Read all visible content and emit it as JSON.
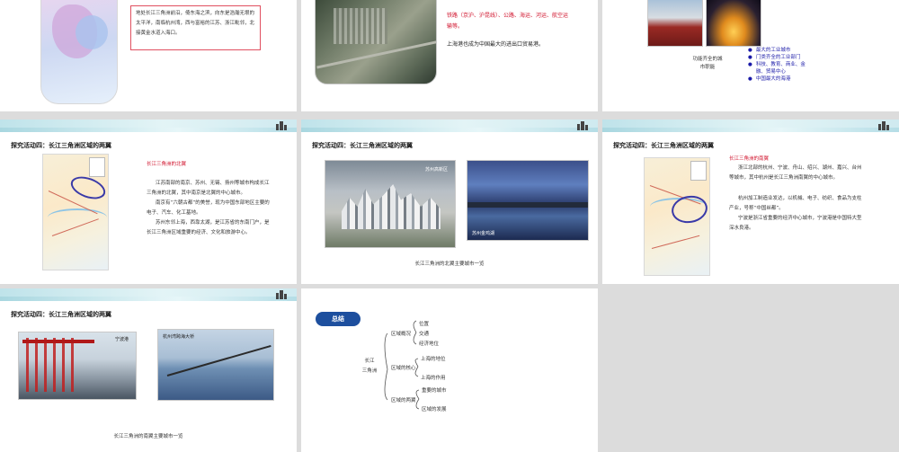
{
  "slides": {
    "s1": {
      "text": "地处长江三角洲前沿，倚东海之滨，向东是浩瀚无垠的太平洋，南临杭州湾，西与富裕的江苏、浙江毗邻，北接黄金水道入海口。"
    },
    "s2": {
      "transport": "铁路（京沪、沪昆线）、公路、海运、河运、航空运输等。",
      "port": "上海港也成为中国最大的进出口贸易港。"
    },
    "s3": {
      "function_label": "功能齐全的城市职能",
      "bullets": [
        "最大的工业城市",
        "门类齐全的工业部门",
        "科技、教育、商业、金融、贸易中心",
        "中国最大的海港"
      ],
      "bullet_color": "#1a1aa8"
    },
    "s4": {
      "title": "探究活动四：长江三角洲区域的两翼",
      "subtitle": "长江三角洲的北翼",
      "paragraphs": [
        "江苏南部的南京、苏州、无锡、扬州等城市构成长江三角洲的北翼，其中南京是北翼的中心城市。",
        "南京有“六朝古都”的美誉，现为中国东部地区主要的电子、汽车、化工基地。",
        "苏州东邻上海，西靠太湖，是江苏省的东南门户，是长江三角洲区域重要的经济、文化和旅游中心。"
      ]
    },
    "s5": {
      "title": "探究活动四：长江三角洲区域的两翼",
      "photo1_label": "苏州高新区",
      "photo2_label": "苏州金鸡湖",
      "caption": "长江三角洲的北翼主要城市一览"
    },
    "s6": {
      "title": "探究活动四：长江三角洲区域的两翼",
      "subtitle": "长江三角洲的南翼",
      "paragraphs": [
        "浙江北部的杭州、宁波、舟山、绍兴、湖州、嘉兴、台州等城市，其中杭州是长江三角洲南翼的中心城市。",
        "杭州加工制造业发达，以机械、电子、纺织、食品为支柱产业，号称“中国丝都”。",
        "宁波是浙江省重要的经济中心城市，宁波港是中国特大型深水良港。"
      ]
    },
    "s7": {
      "title": "探究活动四：长江三角洲区域的两翼",
      "photo1_label": "宁波港",
      "photo2_label": "杭州湾跨海大桥",
      "caption": "长江三角洲的南翼主要城市一览"
    },
    "s8": {
      "badge": "总结",
      "root": [
        "长江",
        "三角洲"
      ],
      "branches": [
        {
          "label": "区域概况",
          "leaves": [
            "位置",
            "交通",
            "经济地位"
          ]
        },
        {
          "label": "区域的核心",
          "leaves": [
            "上海的地位",
            "上海的作用"
          ]
        },
        {
          "label": "区域的两翼",
          "leaves": [
            "重要的城市",
            "区域的发展"
          ]
        }
      ]
    }
  },
  "colors": {
    "accent_red": "#d0102a",
    "badge_blue": "#1d4f9e",
    "canvas_bg": "#dcdcdc"
  }
}
